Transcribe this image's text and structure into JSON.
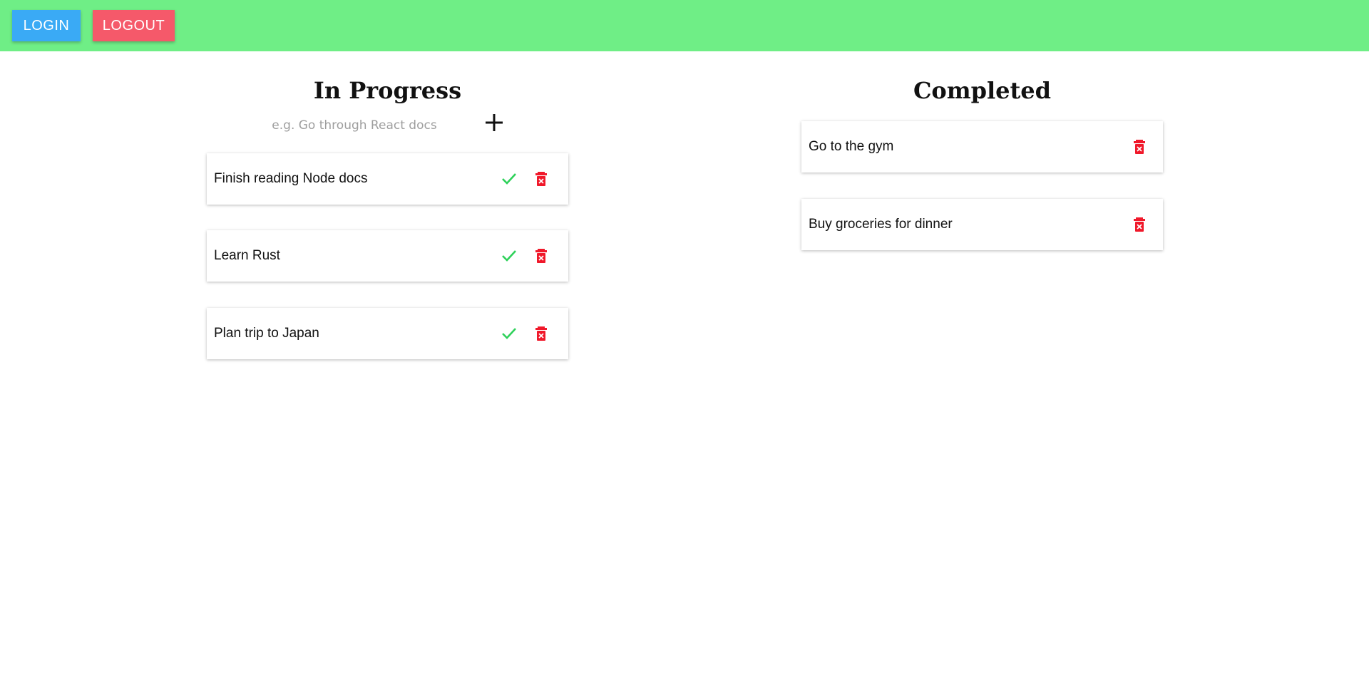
{
  "header": {
    "login_label": "LOGIN",
    "logout_label": "LOGOUT",
    "background_color": "#6fee86",
    "login_color": "#3aaaf5",
    "logout_color": "#f5596a"
  },
  "in_progress": {
    "title": "In Progress",
    "input_placeholder": "e.g. Go through React docs",
    "input_value": "",
    "add_icon": "plus-icon",
    "items": [
      {
        "label": "Finish reading Node docs",
        "complete_icon": "checkmark-icon",
        "delete_icon": "trash-icon"
      },
      {
        "label": "Learn Rust",
        "complete_icon": "checkmark-icon",
        "delete_icon": "trash-icon"
      },
      {
        "label": "Plan trip to Japan",
        "complete_icon": "checkmark-icon",
        "delete_icon": "trash-icon"
      }
    ]
  },
  "completed": {
    "title": "Completed",
    "items": [
      {
        "label": "Go to the gym",
        "delete_icon": "trash-icon"
      },
      {
        "label": "Buy groceries for dinner",
        "delete_icon": "trash-icon"
      }
    ]
  },
  "colors": {
    "check": "#2ed15a",
    "delete": "#f0182a"
  }
}
